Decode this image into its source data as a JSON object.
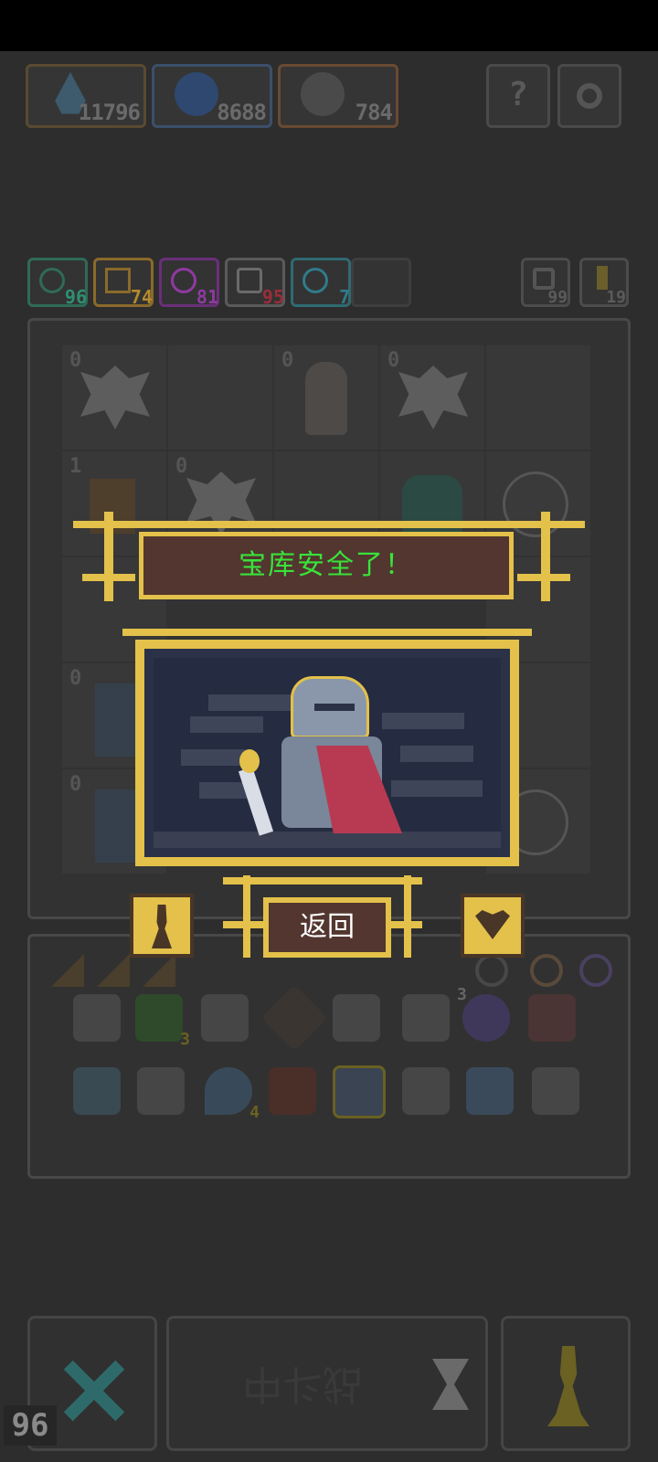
{
  "resources": [
    {
      "icon": "water-drop-icon",
      "value": "11796"
    },
    {
      "icon": "gear-coin-icon",
      "value": "8688"
    },
    {
      "icon": "skull-icon",
      "value": "784"
    }
  ],
  "top_buttons": [
    {
      "icon": "help-icon",
      "label": "?"
    },
    {
      "icon": "settings-icon"
    }
  ],
  "stats": [
    {
      "icon": "eye-icon",
      "value": "96",
      "color": "#2f8f72"
    },
    {
      "icon": "heartbeat-icon",
      "value": "74",
      "color": "#b58a2e"
    },
    {
      "icon": "magic-icon",
      "value": "81",
      "color": "#8e3aa0"
    },
    {
      "icon": "speech-icon",
      "value": "95",
      "color": "#9a2d3a"
    },
    {
      "icon": "clock-icon",
      "value": "7",
      "color": "#2f7b8a"
    }
  ],
  "side_counters": [
    {
      "icon": "recycle-icon",
      "value": "99"
    },
    {
      "icon": "key-icon",
      "value": "19"
    }
  ],
  "board": {
    "cells": [
      {
        "level": "0",
        "kind": "monster"
      },
      {
        "level": "",
        "kind": "empty"
      },
      {
        "level": "0",
        "kind": "merchant"
      },
      {
        "level": "0",
        "kind": "monster"
      },
      {
        "level": "",
        "kind": "empty"
      },
      {
        "level": "1",
        "kind": "wood"
      },
      {
        "level": "0",
        "kind": "monster"
      },
      {
        "level": "",
        "kind": "empty"
      },
      {
        "level": "",
        "kind": "plant"
      },
      {
        "level": "",
        "kind": "bomb"
      }
    ],
    "left_column_levels": [
      "0",
      "0"
    ]
  },
  "inventory": {
    "row1": [
      {
        "icon": "shield-icon",
        "count": ""
      },
      {
        "icon": "green-gem-icon",
        "count": "3"
      },
      {
        "icon": "hammer-icon",
        "count": ""
      },
      {
        "icon": "diamond-icon",
        "count": ""
      },
      {
        "icon": "camera-icon",
        "count": ""
      },
      {
        "icon": "chain-icon",
        "count": ""
      },
      {
        "icon": "flower-icon",
        "count": "3"
      },
      {
        "icon": "crown-icon",
        "count": ""
      }
    ],
    "row2": [
      {
        "icon": "fish-icon",
        "count": ""
      },
      {
        "icon": "syringe-icon",
        "count": ""
      },
      {
        "icon": "drop-icon",
        "count": "4"
      },
      {
        "icon": "log-icon",
        "count": ""
      },
      {
        "icon": "robot-icon",
        "count": ""
      },
      {
        "icon": "basket-icon",
        "count": ""
      },
      {
        "icon": "potion-icon",
        "count": ""
      },
      {
        "icon": "network-icon",
        "count": ""
      }
    ]
  },
  "modal": {
    "title": "宝库安全了！",
    "scene": "knight-with-sword-icon",
    "return_label": "返回"
  },
  "bottom": {
    "mid_label": "战斗中",
    "fps": "96"
  }
}
